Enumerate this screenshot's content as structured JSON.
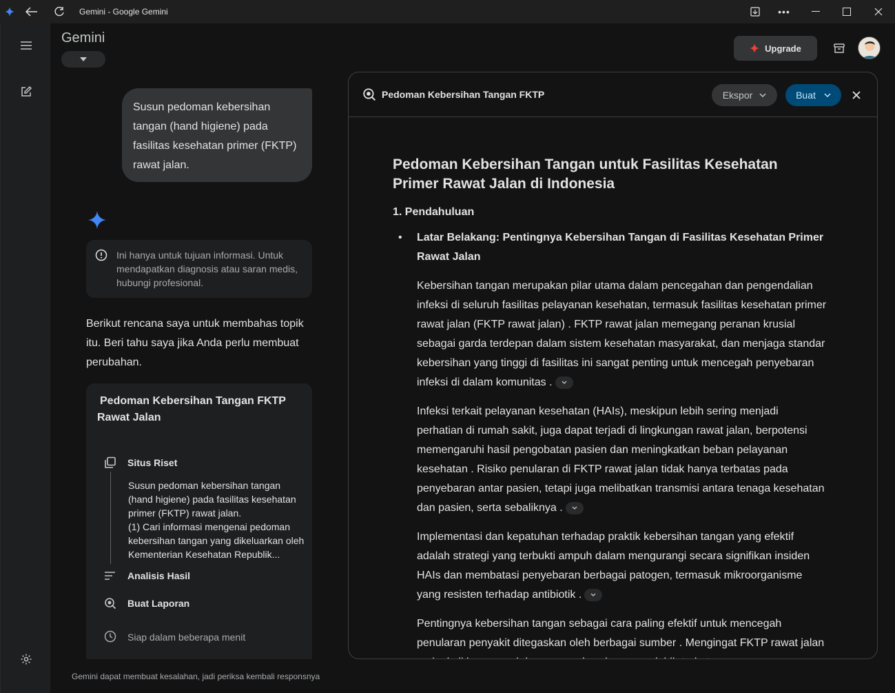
{
  "window": {
    "title": "Gemini - Google Gemini"
  },
  "header": {
    "app_name": "Gemini",
    "upgrade_label": "Upgrade"
  },
  "chat": {
    "user_prompt": "Susun pedoman kebersihan tangan (hand higiene) pada fasilitas kesehatan primer (FKTP) rawat jalan.",
    "disclaimer": "Ini hanya untuk tujuan informasi. Untuk mendapatkan diagnosis atau saran medis, hubungi profesional.",
    "plan_intro": "Berikut rencana saya untuk membahas topik itu. Beri tahu saya jika Anda perlu membuat perubahan.",
    "plan_card": {
      "title": "Pedoman Kebersihan Tangan FKTP Rawat Jalan",
      "step1_label": "Situs Riset",
      "step1_desc": "Susun pedoman kebersihan tangan (hand higiene) pada fasilitas kesehatan primer (FKTP) rawat jalan.\n(1) Cari informasi mengenai pedoman kebersihan tangan yang dikeluarkan oleh Kementerian Kesehatan Republik...",
      "step2_label": "Analisis Hasil",
      "step3_label": "Buat Laporan",
      "ready": "Siap dalam beberapa menit"
    },
    "footer_note": "Gemini dapat membuat kesalahan, jadi periksa kembali responsnya"
  },
  "doc": {
    "header_title": "Pedoman Kebersihan Tangan FKTP",
    "ekspor_label": "Ekspor",
    "buat_label": "Buat",
    "title": "Pedoman Kebersihan Tangan untuk Fasilitas Kesehatan Primer Rawat Jalan di Indonesia",
    "section1": "1. Pendahuluan",
    "bullet1": "Latar Belakang: Pentingnya Kebersihan Tangan di Fasilitas Kesehatan Primer Rawat Jalan",
    "para1": "Kebersihan tangan merupakan pilar utama dalam pencegahan dan pengendalian infeksi di seluruh fasilitas pelayanan kesehatan, termasuk fasilitas kesehatan primer rawat jalan (FKTP rawat jalan) . FKTP rawat jalan memegang peranan krusial sebagai garda terdepan dalam sistem kesehatan masyarakat, dan menjaga standar kebersihan yang tinggi di fasilitas ini sangat penting untuk mencegah penyebaran infeksi di dalam komunitas .",
    "para2": "Infeksi terkait pelayanan kesehatan (HAIs), meskipun lebih sering menjadi perhatian di rumah sakit, juga dapat terjadi di lingkungan rawat jalan, berpotensi memengaruhi hasil pengobatan pasien dan meningkatkan beban pelayanan kesehatan . Risiko penularan di FKTP rawat jalan tidak hanya terbatas pada penyebaran antar pasien, tetapi juga melibatkan transmisi antara tenaga kesehatan dan pasien, serta sebaliknya .",
    "para3": "Implementasi dan kepatuhan terhadap praktik kebersihan tangan yang efektif adalah strategi yang terbukti ampuh dalam mengurangi secara signifikan insiden HAIs dan membatasi penyebaran berbagai patogen, termasuk mikroorganisme yang resisten terhadap antibiotik .",
    "para4": "Pentingnya kebersihan tangan sebagai cara paling efektif untuk mencegah penularan penyakit ditegaskan oleh berbagai sumber . Mengingat FKTP rawat jalan seringkali beroperasi dengan sumber daya yang lebih terbatas"
  },
  "colors": {
    "accent_blue": "#4285f4",
    "buat_bg": "#004a77",
    "upgrade_star": "#ea4335"
  }
}
